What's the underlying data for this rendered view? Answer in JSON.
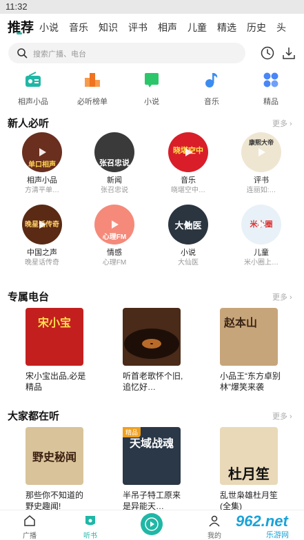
{
  "status_bar": {
    "time": "11:32"
  },
  "tabs": [
    {
      "label": "推荐",
      "active": true
    },
    {
      "label": "小说"
    },
    {
      "label": "音乐"
    },
    {
      "label": "知识"
    },
    {
      "label": "评书"
    },
    {
      "label": "相声"
    },
    {
      "label": "儿童"
    },
    {
      "label": "精选"
    },
    {
      "label": "历史"
    },
    {
      "label": "头"
    }
  ],
  "search": {
    "placeholder": "搜索广播、电台"
  },
  "quick_links": [
    {
      "label": "相声小品",
      "icon": "radio-icon",
      "color": "#20b7a6"
    },
    {
      "label": "必听榜单",
      "icon": "podium-icon",
      "color": "#f0731f"
    },
    {
      "label": "小说",
      "icon": "book-icon",
      "color": "#2cc66a"
    },
    {
      "label": "音乐",
      "icon": "music-note-icon",
      "color": "#3c8cf0"
    },
    {
      "label": "精品",
      "icon": "grid-icon",
      "color": "#4a86f7"
    }
  ],
  "new_listener": {
    "title": "新人必听",
    "more": "更多",
    "items": [
      {
        "title": "相声小品",
        "sub": "方清平单…",
        "cover_text": "单口相声"
      },
      {
        "title": "新闻",
        "sub": "张召忠说",
        "cover_text": "张召忠说"
      },
      {
        "title": "音乐",
        "sub": "晓堪空中…",
        "cover_text": "晓堪空中"
      },
      {
        "title": "评书",
        "sub": "连丽如:…",
        "cover_text": "康熙大帝"
      },
      {
        "title": "中国之声",
        "sub": "晚星话传奇",
        "cover_text": "晚星话传奇"
      },
      {
        "title": "情感",
        "sub": "心理FM",
        "cover_text": "心理FM"
      },
      {
        "title": "小说",
        "sub": "大仙医",
        "cover_text": "大仙医"
      },
      {
        "title": "儿童",
        "sub": "米小圈上…",
        "cover_text": "米小圈"
      }
    ]
  },
  "exclusive": {
    "title": "专属电台",
    "more": "更多",
    "items": [
      {
        "title": "宋小宝出品,必是精品",
        "cover_text": "宋小宝"
      },
      {
        "title": "听首老歌怀个旧,追忆好…",
        "cover_text": ""
      },
      {
        "title": "小品王“东方卓别林”爆笑来袭",
        "cover_text": "赵本山"
      }
    ]
  },
  "popular": {
    "title": "大家都在听",
    "more": "更多",
    "items": [
      {
        "title": "那些你不知道的野史趣闻!",
        "cover_text": "野史秘闻",
        "tag": ""
      },
      {
        "title": "半吊子特工原来是异能天…",
        "cover_text": "天域战魂",
        "tag": "精品"
      },
      {
        "title": "乱世枭雄杜月笙(全集)",
        "cover_text": "杜月笙",
        "tag": ""
      }
    ]
  },
  "bottom_nav": [
    {
      "label": "广播",
      "icon": "home-icon"
    },
    {
      "label": "听书",
      "icon": "bookmark-icon",
      "active": true
    },
    {
      "label": "",
      "icon": "play-icon"
    },
    {
      "label": "我的",
      "icon": "profile-icon"
    }
  ],
  "watermark": {
    "text": "962.net",
    "sub": "乐游网"
  }
}
